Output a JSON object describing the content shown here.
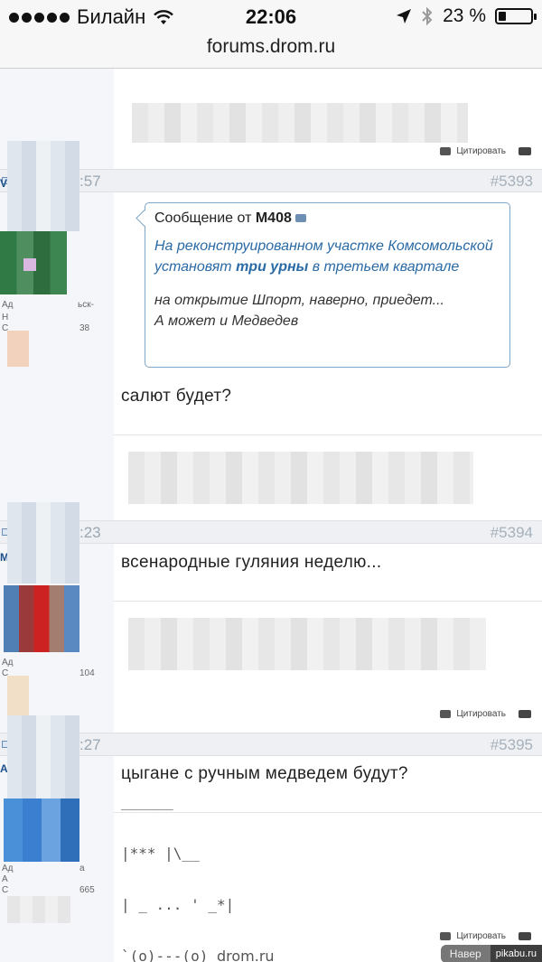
{
  "status_bar": {
    "carrier": "Билайн",
    "time": "22:06",
    "battery_percent_label": "23 %",
    "battery_level": 0.23
  },
  "url_bar": {
    "domain": "forums.drom.ru"
  },
  "posts": [
    {
      "time_partial": ":57",
      "number": "#5393"
    },
    {
      "time_partial": ":23",
      "number": "#5394"
    },
    {
      "time_partial": ":27",
      "number": "#5395"
    }
  ],
  "sidebar_fragments": {
    "post1": {
      "name_initial": "V",
      "line1": "Ад",
      "line1b": "ьск-",
      "line2": "Н",
      "line3": "С",
      "line3b": "38"
    },
    "post2": {
      "name_initial": "M",
      "line1": "Ад",
      "line2": "С",
      "line2b": "104"
    },
    "post3": {
      "name_initial": "А",
      "line1": "Ад",
      "line1b": "а",
      "line2": "А",
      "line3": "С",
      "line3b": "665"
    }
  },
  "quote": {
    "header_prefix": "Сообщение от",
    "author": "M408",
    "body_normal": "На реконструированном участке Комсомольской установят ",
    "body_bold": "три урны",
    "body_tail": " в третьем квартале",
    "extra": "на открытие Шпорт, наверно, приедет...\nА может и Медведев"
  },
  "post_texts": {
    "post1": "салют будет?",
    "post2": "всенародные гуляния неделю...",
    "post3": "цыгане с ручным медведем будут?"
  },
  "quote_button_label": "Цитировать",
  "ascii_art": {
    "line1": "______",
    "line2": "|*** |\\__",
    "line3": "| _ ... ' _*|",
    "line4": "`(o)---(o) ",
    "domain": "drom.ru"
  },
  "watermark": {
    "nav": "Навер",
    "site": "pikabu.ru"
  }
}
